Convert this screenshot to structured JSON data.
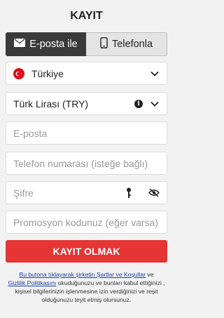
{
  "title": "KAYIT",
  "tabs": [
    {
      "label": "E-posta ile",
      "icon": "envelope-icon",
      "active": true
    },
    {
      "label": "Telefonla",
      "icon": "phone-icon",
      "active": false
    }
  ],
  "country": {
    "value": "Türkiye",
    "icon": "turkey-flag-icon"
  },
  "currency": {
    "value": "Türk Lirası (TRY)"
  },
  "fields": {
    "email_placeholder": "E-posta",
    "phone_placeholder": "Telefon numarası (isteğe bağlı)",
    "password_placeholder": "Şifre",
    "promo_placeholder": "Promosyon kodunuz (eğer varsa)"
  },
  "submit_label": "KAYIT OLMAK",
  "terms": {
    "link1": "Bu butona tıklayarak şirketin Şartlar ve Koşullar",
    "text1": " ve ",
    "link2": "Gizlilik Politikasını",
    "text2": " okuduğunuzu ve bunları kabul ettiğinizi , kişisel bilgilerinizin işlenmesine izin verdiğinizi ve reşit olduğunuzu teyit etmiş olursunuz."
  },
  "colors": {
    "accent": "#e53535",
    "tab_active_bg": "#3a3a3a",
    "link": "#1a3faa"
  }
}
